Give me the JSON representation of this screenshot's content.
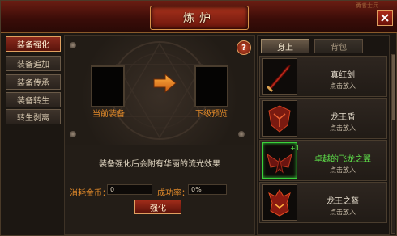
{
  "window": {
    "title": "炼炉",
    "corner_text": "勇者士兵"
  },
  "sidebar": {
    "items": [
      {
        "label": "装备强化",
        "active": true
      },
      {
        "label": "装备追加",
        "active": false
      },
      {
        "label": "装备传承",
        "active": false
      },
      {
        "label": "装备转生",
        "active": false
      },
      {
        "label": "转生剥离",
        "active": false
      }
    ]
  },
  "forge": {
    "help_symbol": "?",
    "current_label": "当前装备",
    "preview_label": "下级预览",
    "info_text": "装备强化后会附有华丽的流光效果",
    "cost_label": "消耗金币：",
    "cost_value": "0",
    "rate_label": "成功率：",
    "rate_value": "0%",
    "forge_button": "强化"
  },
  "inventory": {
    "tabs": [
      {
        "label": "身上"
      },
      {
        "label": "背包"
      }
    ],
    "items": [
      {
        "name": "真红剑",
        "action": "点击放入",
        "icon": "red-sword-icon"
      },
      {
        "name": "龙王盾",
        "action": "点击放入",
        "icon": "dragon-shield-icon"
      },
      {
        "name": "卓越的飞龙之翼",
        "action": "点击放入",
        "icon": "dragon-wings-icon",
        "badge": "+1"
      },
      {
        "name": "龙王之盔",
        "action": "点击放入",
        "icon": "dragon-helmet-icon"
      }
    ]
  },
  "colors": {
    "accent": "#e28a2a",
    "highlight": "#5ee04a",
    "title_bg": "#6a1d12"
  }
}
